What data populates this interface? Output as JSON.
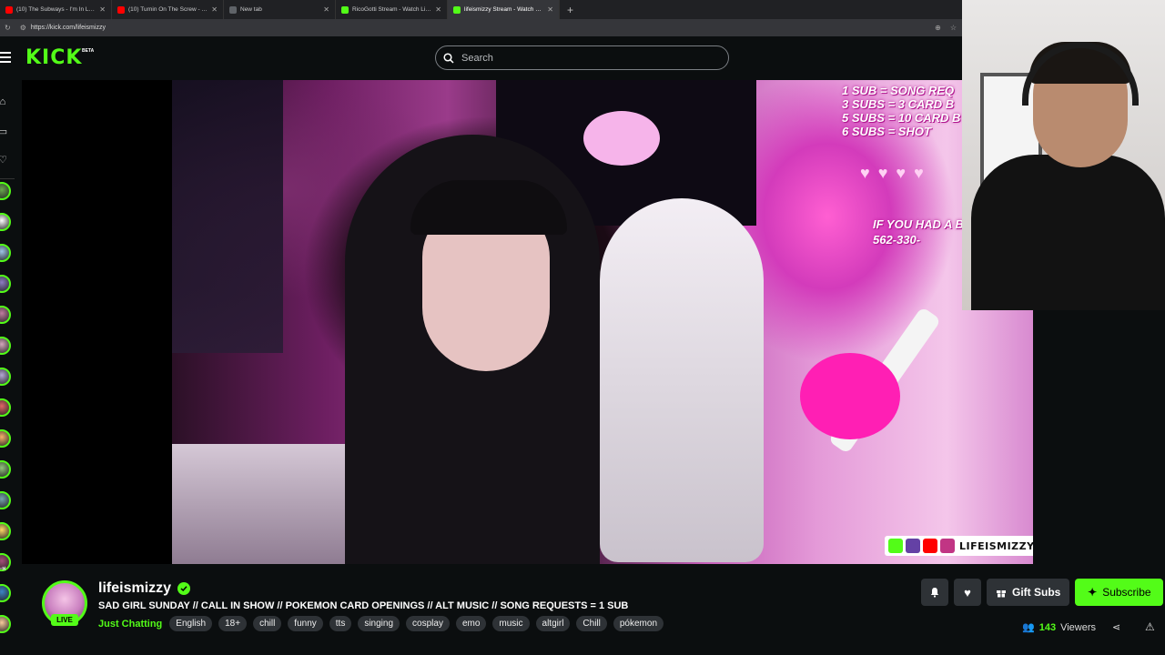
{
  "browser": {
    "tabs": [
      {
        "title": "(10) The Subways - I'm In Love An",
        "favicon_color": "#ff0000",
        "active": false
      },
      {
        "title": "(10) Turnin On The Screw - YouTub",
        "favicon_color": "#ff0000",
        "active": false
      },
      {
        "title": "New tab",
        "favicon_color": "#5f6368",
        "active": false
      },
      {
        "title": "RicoGotti Stream - Watch Live on",
        "favicon_color": "#53fc18",
        "active": false
      },
      {
        "title": "lifeismizzy Stream - Watch Live on",
        "favicon_color": "#53fc18",
        "active": true
      }
    ],
    "new_tab_label": "+",
    "url": "https://kick.com/lifeismizzy"
  },
  "header": {
    "logo": "KICK",
    "beta": "BETA",
    "search_placeholder": "Search"
  },
  "stream_overlay": {
    "sub_menu": [
      "1 SUB = SONG REQ",
      "3 SUBS = 3 CARD B",
      "5 SUBS = 10 CARD B",
      "6 SUBS = SHOT"
    ],
    "hearts": "♥ ♥ ♥ ♥",
    "phone_lines": [
      "IF YOU HAD A BA",
      "562-330-"
    ],
    "social_handle": "LIFEISMIZZY"
  },
  "stream": {
    "channel_name": "lifeismizzy",
    "live_badge": "LIVE",
    "title": "SAD GIRL SUNDAY // CALL IN SHOW // POKEMON CARD OPENINGS // ALT MUSIC // SONG REQUESTS = 1 SUB",
    "category": "Just Chatting",
    "tags": [
      "English",
      "18+",
      "chill",
      "funny",
      "tts",
      "singing",
      "cosplay",
      "emo",
      "music",
      "altgirl",
      "Chill",
      "pókemon"
    ],
    "gift_label": "Gift Subs",
    "subscribe_label": "Subscribe",
    "viewer_count": "143",
    "viewers_label": "Viewers"
  },
  "colors": {
    "accent": "#53fc18",
    "background": "#0b0e0f",
    "chip": "#2e3236"
  },
  "sidebar_channel_colors": [
    "#6aa84f",
    "#ffffff",
    "#9fc5e8",
    "#8e7cc3",
    "#c27ba0",
    "#d5a6bd",
    "#b4a7d6",
    "#e06666",
    "#f6b26b",
    "#93c47d",
    "#76a5af",
    "#ffd966",
    "#a64d79",
    "#3d85c6",
    "#f9cb9c"
  ]
}
